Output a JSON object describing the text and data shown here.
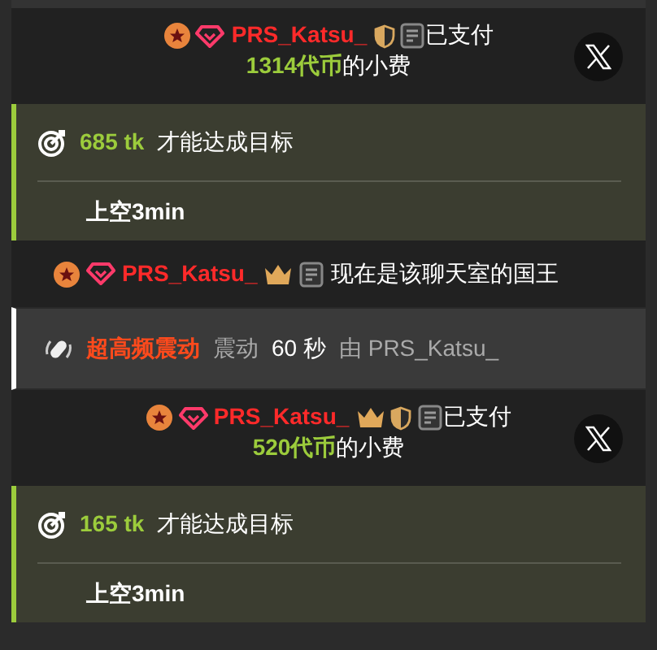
{
  "messages": [
    {
      "kind": "tip",
      "username": "PRS_Katsu_",
      "crown": false,
      "shield": true,
      "action": "已支付",
      "amount": "1314代币",
      "suffix": "的小费"
    },
    {
      "kind": "goal",
      "amount": "685 tk",
      "text": "才能达成目标",
      "title": "上空3min"
    },
    {
      "kind": "king",
      "username": "PRS_Katsu_",
      "crown": true,
      "shield": false,
      "action": "现在是该聊天室的国王"
    },
    {
      "kind": "vibration",
      "level_name": "超高频震动",
      "prefix": "震动",
      "duration": "60 秒",
      "by": "由 PRS_Katsu_"
    },
    {
      "kind": "tip",
      "username": "PRS_Katsu_",
      "crown": true,
      "shield": true,
      "action": "已支付",
      "amount": "520代币",
      "suffix": "的小费"
    },
    {
      "kind": "goal",
      "amount": "165 tk",
      "text": "才能达成目标",
      "title": "上空3min"
    }
  ]
}
